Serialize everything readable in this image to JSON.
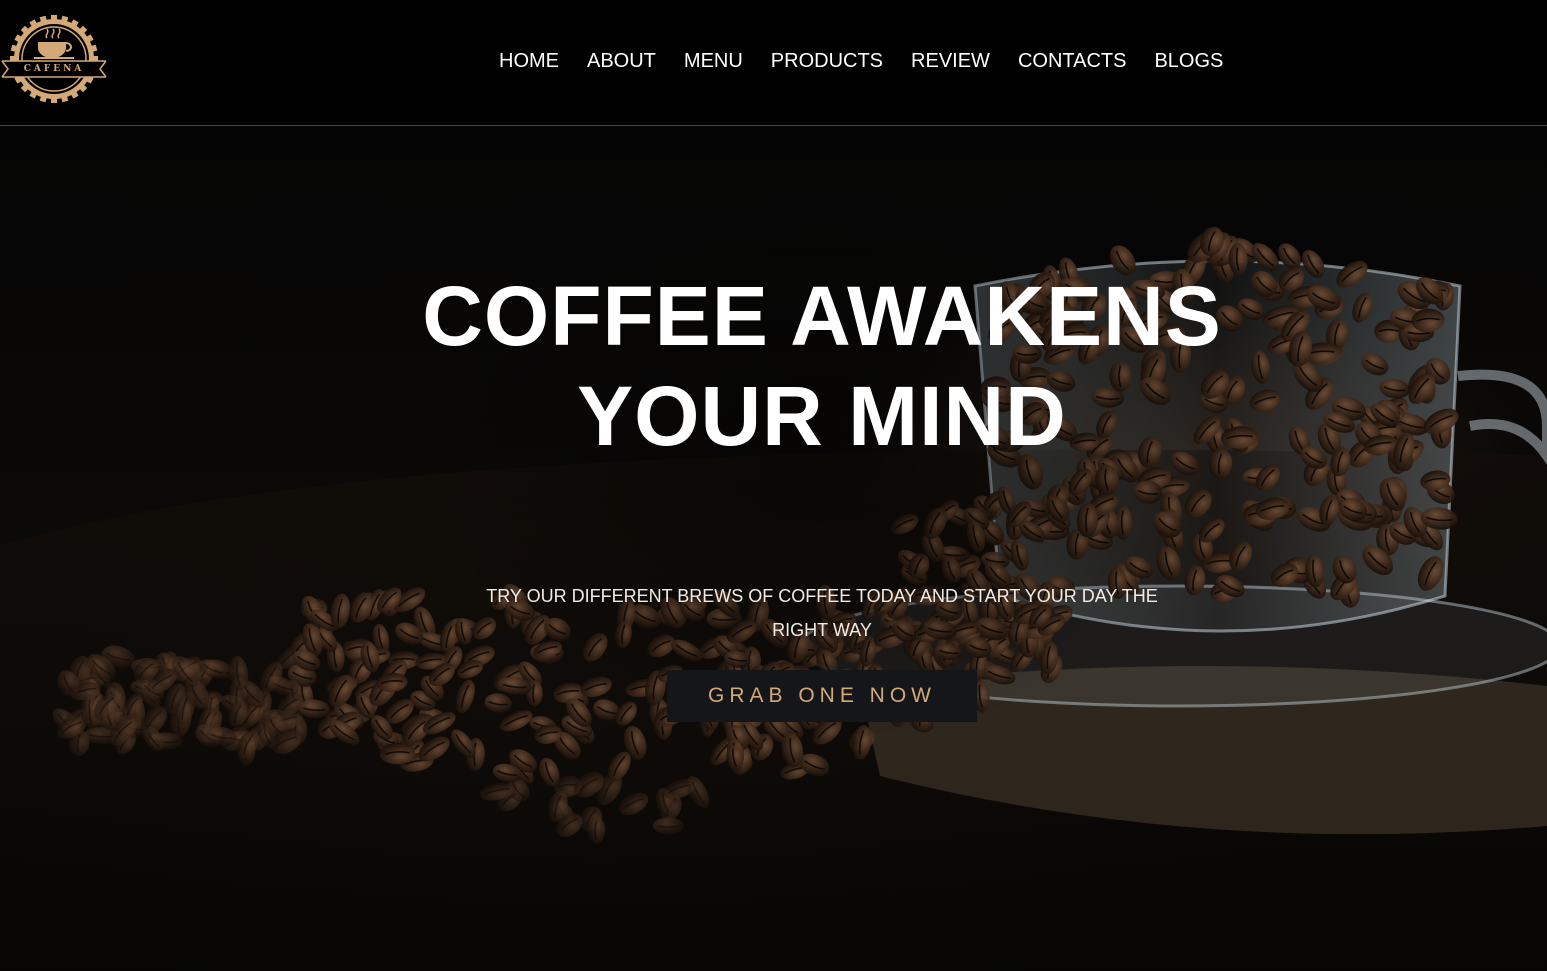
{
  "header": {
    "logo": {
      "text": "CAFENA",
      "icon": "coffee-cup-icon",
      "color": "#d3a977"
    },
    "nav": [
      {
        "label": "HOME"
      },
      {
        "label": "ABOUT"
      },
      {
        "label": "MENU"
      },
      {
        "label": "PRODUCTS"
      },
      {
        "label": "REVIEW"
      },
      {
        "label": "CONTACTS"
      },
      {
        "label": "BLOGS"
      }
    ]
  },
  "hero": {
    "title": "COFFEE AWAKENS YOUR MIND",
    "subtitle": "TRY OUR DIFFERENT BREWS OF COFFEE TODAY AND START YOUR DAY THE RIGHT WAY",
    "cta_label": "GRAB ONE NOW",
    "background": "coffee-beans-in-glass-cup-image",
    "accent_color": "#d3a977"
  }
}
